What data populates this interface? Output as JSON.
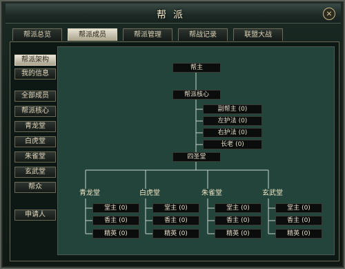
{
  "window": {
    "title": "帮派",
    "close_label": "×"
  },
  "tabs": [
    {
      "label": "帮派总览",
      "active": false
    },
    {
      "label": "帮派成员",
      "active": true
    },
    {
      "label": "帮派管理",
      "active": false
    },
    {
      "label": "帮战记录",
      "active": false
    },
    {
      "label": "联盟大战",
      "active": false
    }
  ],
  "sidebar": {
    "items": [
      {
        "label": "帮派架构",
        "active": true
      },
      {
        "label": "我的信息"
      },
      {
        "label": "全部成员"
      },
      {
        "label": "帮派核心"
      },
      {
        "label": "青龙堂"
      },
      {
        "label": "白虎堂"
      },
      {
        "label": "朱雀堂"
      },
      {
        "label": "玄武堂"
      },
      {
        "label": "帮众"
      },
      {
        "label": "申请人"
      }
    ]
  },
  "org": {
    "leader": "帮主",
    "core": "帮派核心",
    "core_roles": [
      {
        "label": "副帮主",
        "count": "(0)"
      },
      {
        "label": "左护法",
        "count": "(0)"
      },
      {
        "label": "右护法",
        "count": "(0)"
      },
      {
        "label": "长老",
        "count": "(0)"
      }
    ],
    "halls_root": "四圣堂",
    "halls": [
      {
        "name": "青龙堂",
        "roles": [
          {
            "label": "堂主",
            "count": "(0)"
          },
          {
            "label": "香主",
            "count": "(0)"
          },
          {
            "label": "精英",
            "count": "(0)"
          }
        ]
      },
      {
        "name": "白虎堂",
        "roles": [
          {
            "label": "堂主",
            "count": "(0)"
          },
          {
            "label": "香主",
            "count": "(0)"
          },
          {
            "label": "精英",
            "count": "(0)"
          }
        ]
      },
      {
        "name": "朱雀堂",
        "roles": [
          {
            "label": "堂主",
            "count": "(0)"
          },
          {
            "label": "香主",
            "count": "(0)"
          },
          {
            "label": "精英",
            "count": "(0)"
          }
        ]
      },
      {
        "name": "玄武堂",
        "roles": [
          {
            "label": "堂主",
            "count": "(0)"
          },
          {
            "label": "香主",
            "count": "(0)"
          },
          {
            "label": "精英",
            "count": "(0)"
          }
        ]
      }
    ]
  }
}
